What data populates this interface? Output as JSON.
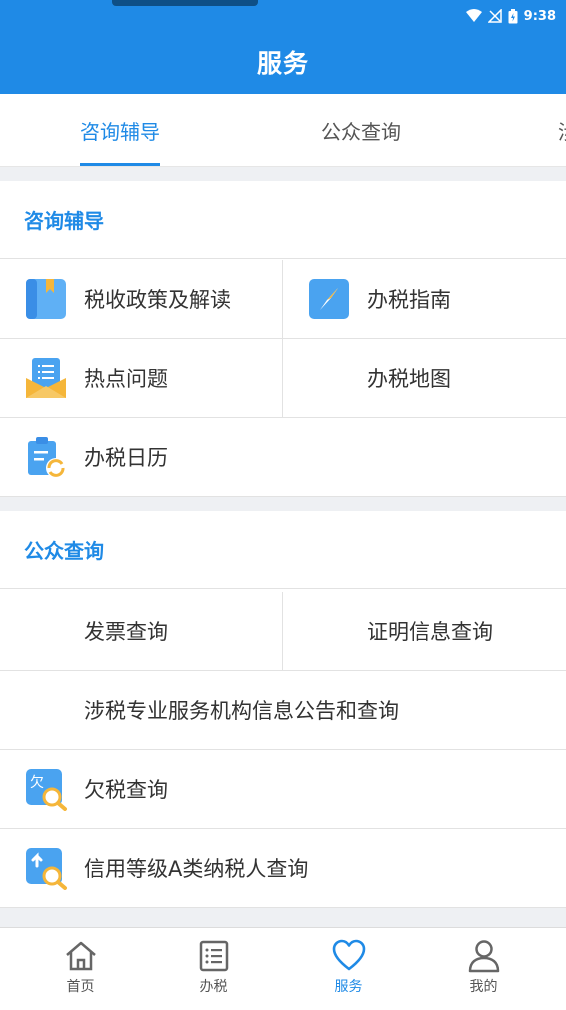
{
  "status_bar": {
    "time": "9:38"
  },
  "header": {
    "title": "服务"
  },
  "tabs": [
    {
      "label": "咨询辅导",
      "active": true
    },
    {
      "label": "公众查询",
      "active": false
    },
    {
      "label": "涉",
      "active": false
    }
  ],
  "sections": [
    {
      "title": "咨询辅导",
      "items": [
        {
          "label": "税收政策及解读",
          "icon": "book-icon"
        },
        {
          "label": "办税指南",
          "icon": "compass-icon"
        },
        {
          "label": "热点问题",
          "icon": "mail-list-icon"
        },
        {
          "label": "办税地图",
          "icon": ""
        },
        {
          "label": "办税日历",
          "icon": "calendar-refresh-icon"
        }
      ]
    },
    {
      "title": "公众查询",
      "items": [
        {
          "label": "发票查询",
          "icon": ""
        },
        {
          "label": "证明信息查询",
          "icon": ""
        },
        {
          "label": "涉税专业服务机构信息公告和查询",
          "icon": ""
        },
        {
          "label": "欠税查询",
          "icon": "tax-search-icon"
        },
        {
          "label": "信用等级A类纳税人查询",
          "icon": "credit-search-icon"
        }
      ]
    }
  ],
  "tabbar": [
    {
      "label": "首页",
      "icon": "home-icon",
      "active": false
    },
    {
      "label": "办税",
      "icon": "list-icon",
      "active": false
    },
    {
      "label": "服务",
      "icon": "heart-icon",
      "active": true
    },
    {
      "label": "我的",
      "icon": "user-icon",
      "active": false
    }
  ],
  "colors": {
    "accent": "#1f8ae6",
    "gap": "#eef0f3",
    "text": "#333333"
  }
}
